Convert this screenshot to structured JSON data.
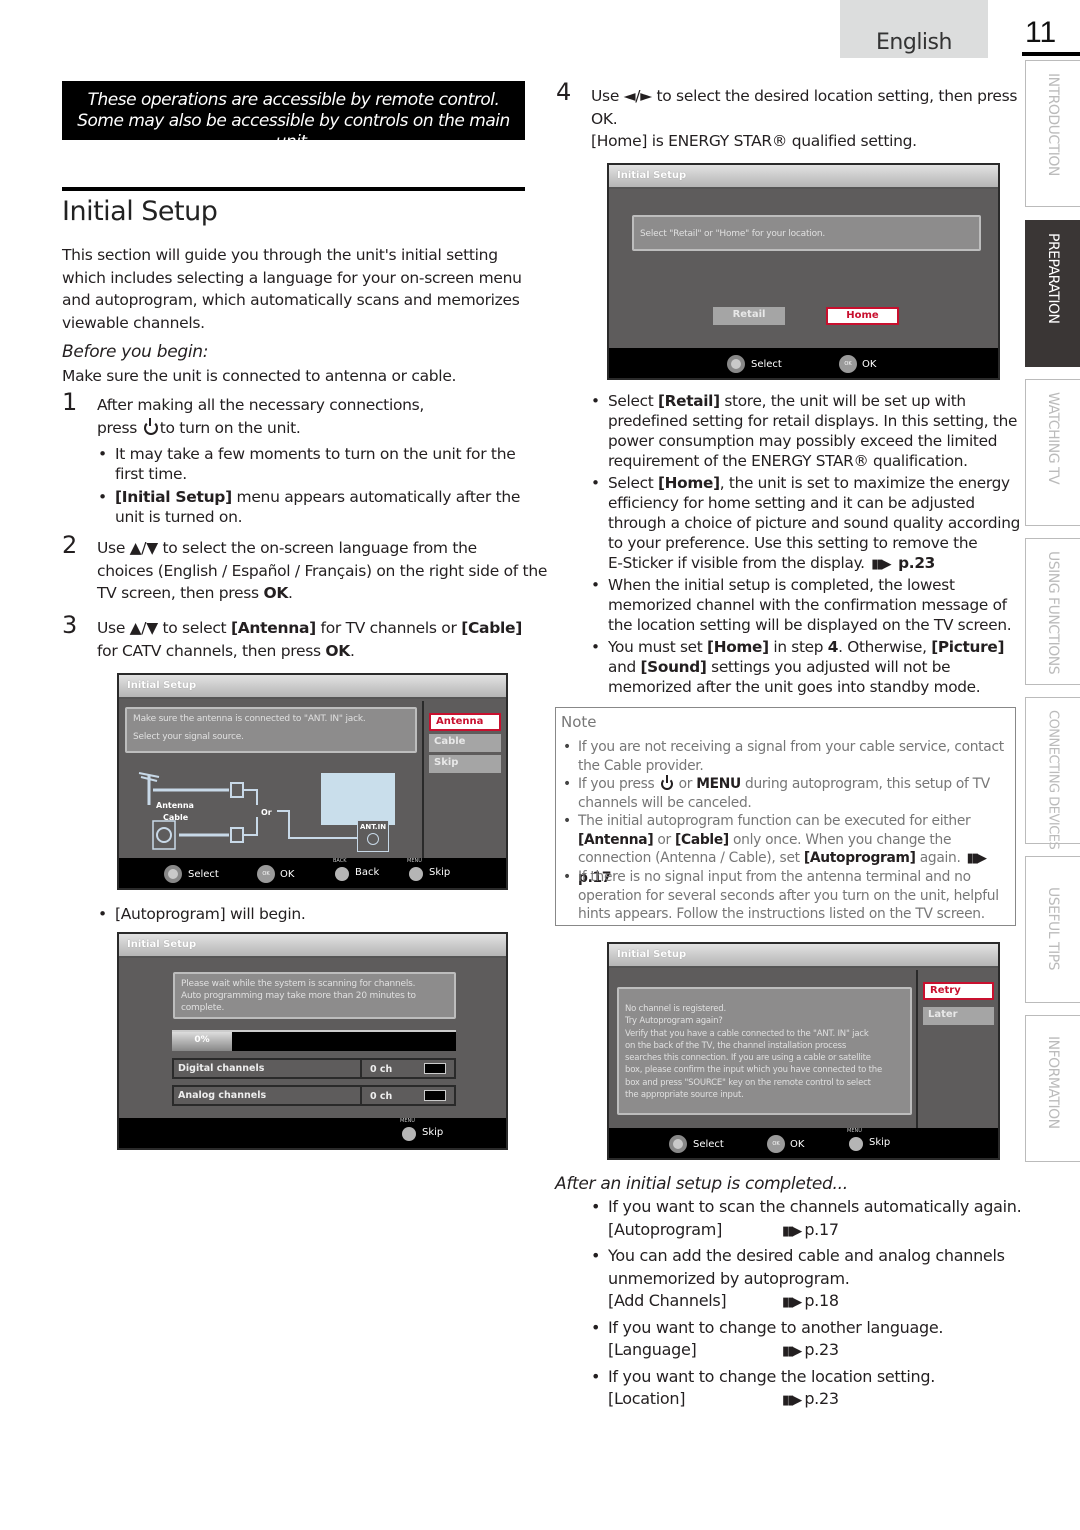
{
  "header": {
    "language": "English",
    "page_number": "11"
  },
  "side_tabs": [
    {
      "label": "INTRODUCTION",
      "active": false
    },
    {
      "label": "PREPARATION",
      "active": true
    },
    {
      "label": "WATCHING TV",
      "active": false
    },
    {
      "label": "USING FUNCTIONS",
      "active": false
    },
    {
      "label": "CONNECTING DEVICES",
      "active": false
    },
    {
      "label": "USEFUL TIPS",
      "active": false
    },
    {
      "label": "INFORMATION",
      "active": false
    }
  ],
  "banner": {
    "line1": "These operations are accessible by remote control.",
    "line2": "Some may also be accessible by controls on the main unit."
  },
  "title": "Initial Setup",
  "intro": [
    "This section will guide you through the unit's initial setting",
    "which includes selecting a language for your on-screen menu",
    "and autoprogram, which automatically scans and memorizes",
    "viewable channels."
  ],
  "before": {
    "heading": "Before you begin:",
    "text": "Make sure the unit is connected to antenna or cable."
  },
  "steps": {
    "s1": {
      "num": "1",
      "line1": "After making all the necessary connections,",
      "line2a": "press",
      "line2b": "to turn on the unit.",
      "b1": "It may take a few moments to turn on the unit for the",
      "b1b": "first time.",
      "b2_bold": "[Initial Setup]",
      "b2": " menu appears automatically after the",
      "b2b": "unit is turned on."
    },
    "s2": {
      "num": "2",
      "line1": "Use ▲/▼ to select the on-screen language from the",
      "line2": "choices (English / Español / Français) on the right side of the",
      "line3a": "TV screen, then press ",
      "line3_bold": "OK",
      "line3b": "."
    },
    "s3": {
      "num": "3",
      "line1a": "Use ▲/▼ to select ",
      "line1_bold1": "[Antenna]",
      "line1b": " for TV channels or ",
      "line1_bold2": "[Cable]",
      "line2a": "for CATV channels, then press ",
      "line2_bold": "OK",
      "line2b": "."
    },
    "s4": {
      "num": "4",
      "line1": "Use ◄/► to select the desired location setting, then press",
      "line2_bold": "OK",
      "line2b": ".",
      "line3_bold": "[Home]",
      "line3": " is ENERGY STAR® qualified setting."
    }
  },
  "autoprogram_begins": {
    "bold": "[Autoprogram]",
    "text": " will begin."
  },
  "tv_signal": {
    "title": "Initial Setup",
    "msg1": "Make sure the antenna is connected to \"ANT. IN\" jack.",
    "msg2": "Select your signal source.",
    "options": [
      "Antenna",
      "Cable",
      "Skip"
    ],
    "selected": "Antenna",
    "diagram": {
      "antenna": "Antenna",
      "cable": "Cable",
      "or": "Or",
      "ant_in": "ANT.IN"
    },
    "footer": {
      "select": "Select",
      "ok": "OK",
      "back_key": "BACK",
      "back": "Back",
      "menu_key": "MENU",
      "skip": "Skip"
    }
  },
  "tv_scan": {
    "title": "Initial Setup",
    "msg": [
      "Please wait while the system is scanning for channels.",
      "Auto programming may take more than 20 minutes to",
      "complete."
    ],
    "progress_label": "0%",
    "progress_value": 0,
    "rows": [
      {
        "label": "Digital channels",
        "value": "0 ch"
      },
      {
        "label": "Analog channels",
        "value": "0 ch"
      }
    ],
    "footer": {
      "menu_key": "MENU",
      "skip": "Skip"
    }
  },
  "tv_location": {
    "title": "Initial Setup",
    "msg": "Select \"Retail\" or \"Home\" for your location.",
    "buttons": [
      "Retail",
      "Home"
    ],
    "selected": "Home",
    "footer": {
      "select": "Select",
      "ok": "OK"
    }
  },
  "location_bullets": [
    {
      "lines": [
        "Select <b>[Retail]</b> store, the unit will be set up with",
        "predefined setting for retail displays. In this setting, the",
        "power consumption may possibly exceed the limited",
        "requirement of the ENERGY STAR® qualification."
      ]
    },
    {
      "lines": [
        "Select <b>[Home]</b>, the unit is set to maximize the energy",
        "efficiency for home setting and it can be adjusted",
        "through a choice of picture and sound quality according",
        "to your preference. Use this setting to remove the",
        "E-Sticker if visible from the display. ➠ <b>p.23</b>"
      ]
    },
    {
      "lines": [
        "When the initial setup is completed, the lowest",
        "memorized channel with the confirmation message of",
        "the location setting will be displayed on the TV screen."
      ]
    },
    {
      "lines": [
        "You must set <b>[Home]</b> in step <b>4</b>. Otherwise, <b>[Picture]</b>",
        "and <b>[Sound]</b> settings you adjusted will not be",
        "memorized after the unit goes into standby mode."
      ]
    }
  ],
  "note": {
    "title": "Note",
    "items": [
      "If you are not receiving a signal from your cable service, contact<br>the Cable provider.",
      "If you press ⏻ or <b>MENU</b> during autoprogram, this setup of TV<br>channels will be canceled.",
      "The initial autoprogram function can be executed for either<br><b>[Antenna]</b> or <b>[Cable]</b> only once. When you change the<br>connection (Antenna / Cable), set <b>[Autoprogram]</b> again. ➠ <b>p.17</b>",
      "If there is no signal input from the antenna terminal and no<br>operation for several seconds after you turn on the unit, helpful<br>hints appears. Follow the instructions listed on the TV screen."
    ]
  },
  "tv_nochannel": {
    "title": "Initial Setup",
    "msg": [
      "No channel is registered.",
      "Try Autoprogram again?",
      "Verify that you have a cable connected to the \"ANT. IN\" jack",
      "on the back of the TV, the channel installation process",
      "searches this connection. If you are using a cable or satellite",
      "box, please confirm the input which you have connected to the",
      "box and press \"SOURCE\" key on the remote control to select",
      "the appropriate source input."
    ],
    "options": [
      "Retry",
      "Later"
    ],
    "selected": "Retry",
    "footer": {
      "select": "Select",
      "ok": "OK",
      "menu_key": "MENU",
      "skip": "Skip"
    }
  },
  "after": {
    "heading": "After an initial setup is completed...",
    "items": [
      {
        "desc": [
          "If you want to scan the channels automatically again."
        ],
        "menu": "[Autoprogram]",
        "page": "p.17"
      },
      {
        "desc": [
          " You can add the desired cable and analog channels",
          "unmemorized by autoprogram."
        ],
        "menu": "[Add Channels]",
        "page": "p.18"
      },
      {
        "desc": [
          "If you want to change to another language."
        ],
        "menu": "[Language]",
        "page": "p.23"
      },
      {
        "desc": [
          "If you want to change the location setting."
        ],
        "menu": "[Location]",
        "page": "p.23"
      }
    ]
  },
  "colors": {
    "accent_red": "#c8102e",
    "tab_active": "#3a3635",
    "tv_bg": "#5e5c5c"
  }
}
